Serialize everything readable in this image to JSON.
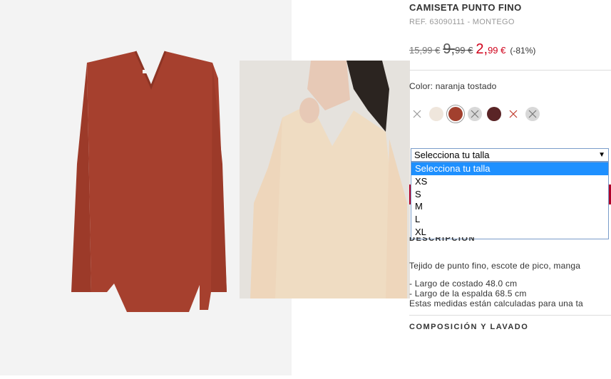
{
  "product": {
    "title": "CAMISETA PUNTO FINO",
    "ref": "REF. 63090111 - MONTEGO"
  },
  "price": {
    "old": "15,99 €",
    "mid_int": "9,",
    "mid_dec": "99 €",
    "new_int": "2,",
    "new_dec": "99 €",
    "discount": "(-81%)"
  },
  "color": {
    "label": "Color: naranja tostado",
    "swatches": [
      {
        "name": "unavailable-swatch",
        "color": "#ffffff",
        "available": false
      },
      {
        "name": "cream-swatch",
        "color": "#efe6dc",
        "available": true
      },
      {
        "name": "burnt-orange-swatch",
        "color": "#a2402e",
        "available": true,
        "selected": true
      },
      {
        "name": "grey-unavailable-swatch",
        "color": "#d8d8d8",
        "available": false
      },
      {
        "name": "burgundy-swatch",
        "color": "#5a2426",
        "available": true
      },
      {
        "name": "red-unavailable-swatch",
        "color": "#ffffff",
        "available": false,
        "accent": "#c0392b"
      },
      {
        "name": "grey2-unavailable-swatch",
        "color": "#d8d8d8",
        "available": false
      }
    ]
  },
  "size": {
    "selected": "Selecciona tu talla",
    "options": [
      "Selecciona tu talla",
      "XS",
      "S",
      "M",
      "L",
      "XL"
    ]
  },
  "description": {
    "heading": "DESCRIPCIÓN",
    "text": "Tejido de punto fino, escote de pico, manga",
    "measure1": "- Largo de costado 48.0 cm",
    "measure2": "- Largo de la espalda 68.5 cm",
    "note": "Estas medidas están calculadas para una ta"
  },
  "composition": {
    "heading": "COMPOSICIÓN Y LAVADO"
  },
  "colors": {
    "price_red": "#d0021b",
    "select_border": "#7a9cc9",
    "dropdown_highlight": "#1e90ff",
    "button": "#b0002a"
  }
}
